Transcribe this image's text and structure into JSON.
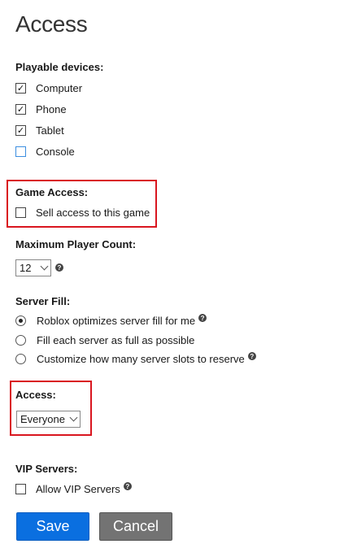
{
  "page": {
    "title": "Access"
  },
  "devices": {
    "label": "Playable devices:",
    "items": [
      {
        "label": "Computer",
        "checked": true
      },
      {
        "label": "Phone",
        "checked": true
      },
      {
        "label": "Tablet",
        "checked": true
      },
      {
        "label": "Console",
        "checked": false
      }
    ]
  },
  "game_access": {
    "label": "Game Access:",
    "sell_label": "Sell access to this game",
    "sell_checked": false
  },
  "max_players": {
    "label": "Maximum Player Count:",
    "value": "12"
  },
  "server_fill": {
    "label": "Server Fill:",
    "options": [
      {
        "label": "Roblox optimizes server fill for me",
        "selected": true
      },
      {
        "label": "Fill each server as full as possible",
        "selected": false
      },
      {
        "label": "Customize how many server slots to reserve",
        "selected": false
      }
    ]
  },
  "access": {
    "label": "Access:",
    "value": "Everyone"
  },
  "vip": {
    "label": "VIP Servers:",
    "allow_label": "Allow VIP Servers",
    "allow_checked": false
  },
  "buttons": {
    "save": "Save",
    "cancel": "Cancel"
  },
  "colors": {
    "save": "#0a6fe0",
    "cancel": "#737373",
    "highlight": "#d9161f",
    "console_checkbox": "#3c8ee0"
  },
  "icons": {
    "help": "question-circle-icon"
  }
}
